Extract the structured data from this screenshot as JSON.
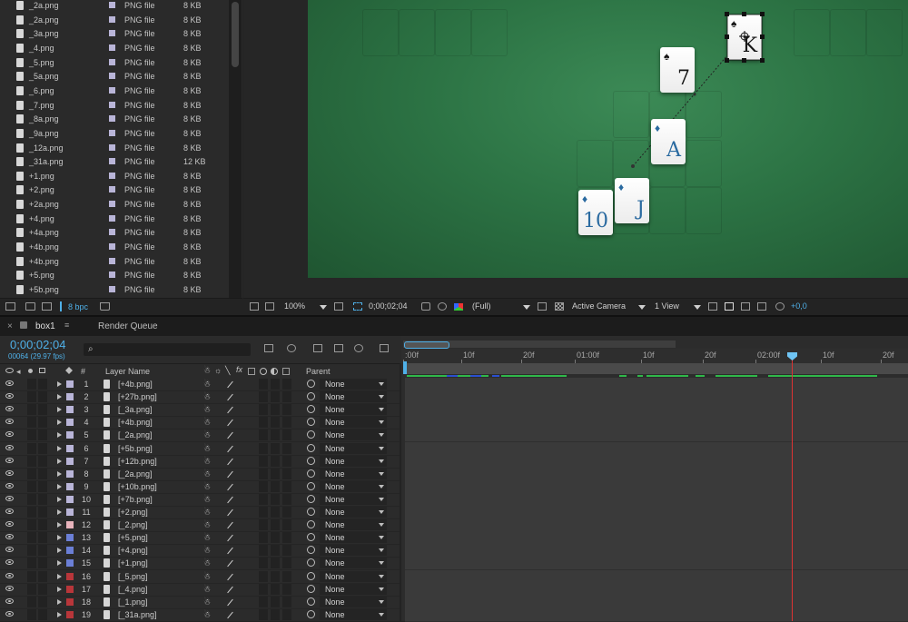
{
  "project": {
    "files": [
      {
        "name": "_2a.png",
        "type": "PNG file",
        "size": "8 KB"
      },
      {
        "name": "_2a.png",
        "type": "PNG file",
        "size": "8 KB"
      },
      {
        "name": "_3a.png",
        "type": "PNG file",
        "size": "8 KB"
      },
      {
        "name": "_4.png",
        "type": "PNG file",
        "size": "8 KB"
      },
      {
        "name": "_5.png",
        "type": "PNG file",
        "size": "8 KB"
      },
      {
        "name": "_5a.png",
        "type": "PNG file",
        "size": "8 KB"
      },
      {
        "name": "_6.png",
        "type": "PNG file",
        "size": "8 KB"
      },
      {
        "name": "_7.png",
        "type": "PNG file",
        "size": "8 KB"
      },
      {
        "name": "_8a.png",
        "type": "PNG file",
        "size": "8 KB"
      },
      {
        "name": "_9a.png",
        "type": "PNG file",
        "size": "8 KB"
      },
      {
        "name": "_12a.png",
        "type": "PNG file",
        "size": "8 KB"
      },
      {
        "name": "_31a.png",
        "type": "PNG file",
        "size": "12 KB"
      },
      {
        "name": "+1.png",
        "type": "PNG file",
        "size": "8 KB"
      },
      {
        "name": "+2.png",
        "type": "PNG file",
        "size": "8 KB"
      },
      {
        "name": "+2a.png",
        "type": "PNG file",
        "size": "8 KB"
      },
      {
        "name": "+4.png",
        "type": "PNG file",
        "size": "8 KB"
      },
      {
        "name": "+4a.png",
        "type": "PNG file",
        "size": "8 KB"
      },
      {
        "name": "+4b.png",
        "type": "PNG file",
        "size": "8 KB"
      },
      {
        "name": "+4b.png",
        "type": "PNG file",
        "size": "8 KB"
      },
      {
        "name": "+5.png",
        "type": "PNG file",
        "size": "8 KB"
      },
      {
        "name": "+5b.png",
        "type": "PNG file",
        "size": "8 KB"
      }
    ],
    "bpc": "8 bpc"
  },
  "viewer": {
    "cards": [
      {
        "rank": "K",
        "suit": "♠",
        "color": "black"
      },
      {
        "rank": "7",
        "suit": "♠",
        "color": "black"
      },
      {
        "rank": "A",
        "suit": "♦",
        "color": "blue"
      },
      {
        "rank": "J",
        "suit": "♦",
        "color": "blue"
      },
      {
        "rank": "10",
        "suit": "♦",
        "color": "blue"
      }
    ],
    "zoom": "100%",
    "timecode": "0;00;02;04",
    "resolution": "(Full)",
    "camera": "Active Camera",
    "view": "1 View",
    "exposure": "+0,0"
  },
  "timeline": {
    "comp_tab": "box1",
    "render_tab": "Render Queue",
    "timecode": "0;00;02;04",
    "frame_info": "00064 (29.97 fps)",
    "search_placeholder": "",
    "columns": {
      "layer_name": "Layer Name",
      "number": "#",
      "parent": "Parent"
    },
    "ruler": [
      ":00f",
      "10f",
      "20f",
      "01:00f",
      "10f",
      "20f",
      "02:00f",
      "10f",
      "20f"
    ],
    "layers": [
      {
        "num": "1",
        "name": "[+4b.png]",
        "label": "#b9b5d8",
        "parent": "None"
      },
      {
        "num": "2",
        "name": "[+27b.png]",
        "label": "#b9b5d8",
        "parent": "None"
      },
      {
        "num": "3",
        "name": "[_3a.png]",
        "label": "#b9b5d8",
        "parent": "None"
      },
      {
        "num": "4",
        "name": "[+4b.png]",
        "label": "#b9b5d8",
        "parent": "None"
      },
      {
        "num": "5",
        "name": "[_2a.png]",
        "label": "#b9b5d8",
        "parent": "None"
      },
      {
        "num": "6",
        "name": "[+5b.png]",
        "label": "#b9b5d8",
        "parent": "None"
      },
      {
        "num": "7",
        "name": "[+12b.png]",
        "label": "#b9b5d8",
        "parent": "None"
      },
      {
        "num": "8",
        "name": "[_2a.png]",
        "label": "#b9b5d8",
        "parent": "None"
      },
      {
        "num": "9",
        "name": "[+10b.png]",
        "label": "#b9b5d8",
        "parent": "None"
      },
      {
        "num": "10",
        "name": "[+7b.png]",
        "label": "#b9b5d8",
        "parent": "None"
      },
      {
        "num": "11",
        "name": "[+2.png]",
        "label": "#b9b5d8",
        "parent": "None"
      },
      {
        "num": "12",
        "name": "[_2.png]",
        "label": "#e8b4bc",
        "parent": "None"
      },
      {
        "num": "13",
        "name": "[+5.png]",
        "label": "#6b7fd6",
        "parent": "None"
      },
      {
        "num": "14",
        "name": "[+4.png]",
        "label": "#6b7fd6",
        "parent": "None"
      },
      {
        "num": "15",
        "name": "[+1.png]",
        "label": "#6b7fd6",
        "parent": "None"
      },
      {
        "num": "16",
        "name": "[_5.png]",
        "label": "#b8363a",
        "parent": "None"
      },
      {
        "num": "17",
        "name": "[_4.png]",
        "label": "#b8363a",
        "parent": "None"
      },
      {
        "num": "18",
        "name": "[_1.png]",
        "label": "#b8363a",
        "parent": "None"
      },
      {
        "num": "19",
        "name": "[_31a.png]",
        "label": "#b8363a",
        "parent": "None"
      }
    ]
  },
  "colors": {
    "accent": "#4fb0e8",
    "playhead": "#dd3333",
    "felt": "#2c7344",
    "marker": "#2fb84a"
  }
}
